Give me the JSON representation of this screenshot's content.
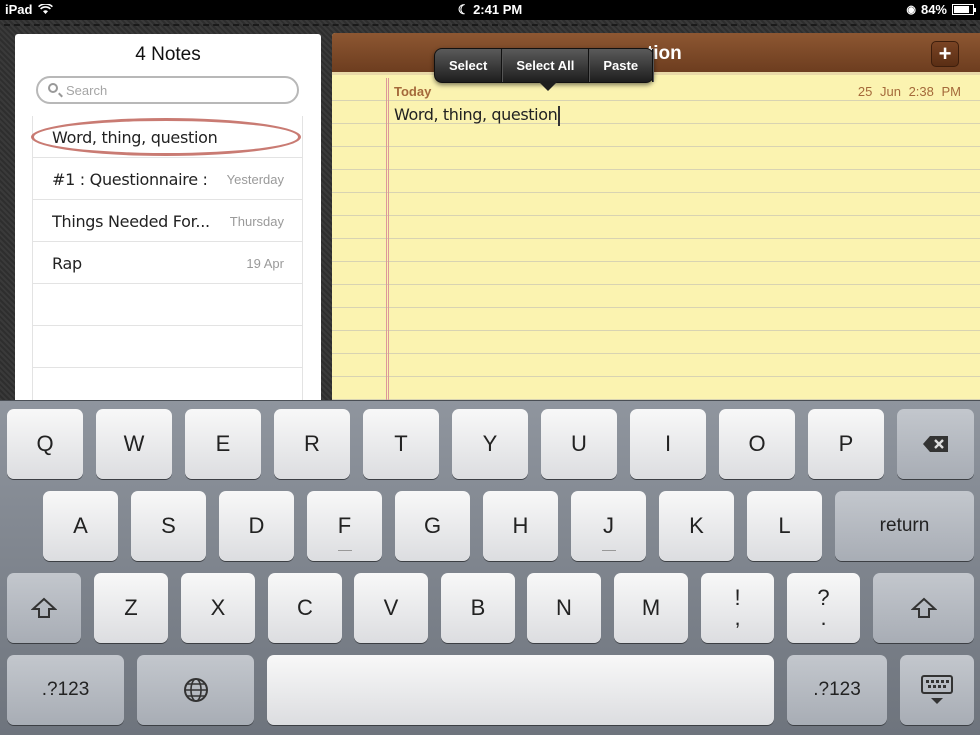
{
  "status_bar": {
    "device": "iPad",
    "time": "2:41 PM",
    "battery": "84%",
    "battery_level": 0.84
  },
  "notes_list": {
    "title": "4 Notes",
    "search_placeholder": "Search",
    "items": [
      {
        "title": "Word, thing, question",
        "date": ""
      },
      {
        "title": "#1 : Questionnaire :",
        "date": "Yesterday"
      },
      {
        "title": "Things Needed For...",
        "date": "Thursday"
      },
      {
        "title": "Rap",
        "date": "19 Apr"
      }
    ]
  },
  "note": {
    "header_title": ", question",
    "add_label": "+",
    "day_label": "Today",
    "date": "25 Jun",
    "time": "2:38 PM",
    "body": "Word, thing, question"
  },
  "edit_menu": {
    "select": "Select",
    "select_all": "Select All",
    "paste": "Paste"
  },
  "keyboard": {
    "row1": [
      "Q",
      "W",
      "E",
      "R",
      "T",
      "Y",
      "U",
      "I",
      "O",
      "P"
    ],
    "row2": [
      "A",
      "S",
      "D",
      "F",
      "G",
      "H",
      "J",
      "K",
      "L"
    ],
    "return": "return",
    "row3": [
      "Z",
      "X",
      "C",
      "V",
      "B",
      "N",
      "M"
    ],
    "excl_top": "!",
    "excl_bottom": ",",
    "quest_top": "?",
    "quest_bottom": ".",
    "numbers_label": ".?123"
  },
  "colors": {
    "note_paper": "#fbf3b0",
    "header_leather": "#8d5732",
    "selection_circle": "#c0645a",
    "date_brown": "#a4693a"
  }
}
